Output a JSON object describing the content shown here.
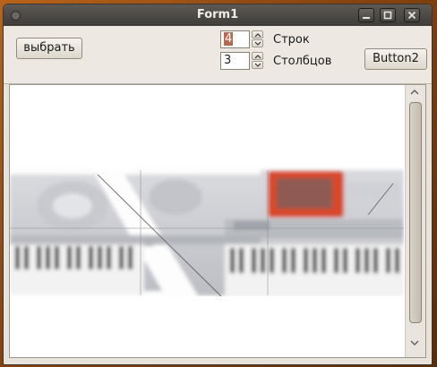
{
  "window": {
    "title": "Form1"
  },
  "toolbar": {
    "choose_button": "выбрать",
    "button2": "Button2",
    "rows": {
      "value": "4",
      "label": "Строк"
    },
    "cols": {
      "value": "3",
      "label": "Столбцов"
    }
  },
  "icons": {
    "window_menu": "window-menu-icon",
    "minimize": "minimize-icon",
    "maximize": "maximize-icon",
    "close": "close-icon",
    "spin_up": "chevron-up-icon",
    "spin_down": "chevron-down-icon",
    "scroll_up": "chevron-up-icon",
    "scroll_down": "chevron-down-icon"
  },
  "image": {
    "subject": "keyboard synthesizer puzzle tiles (blurred)"
  },
  "colors": {
    "titlebar": "#4a4844",
    "accent_selection": "#b5694f",
    "desktop": "#8a4510",
    "tile_red": "#d84a2a"
  },
  "scroll": {
    "position": 0.0
  }
}
